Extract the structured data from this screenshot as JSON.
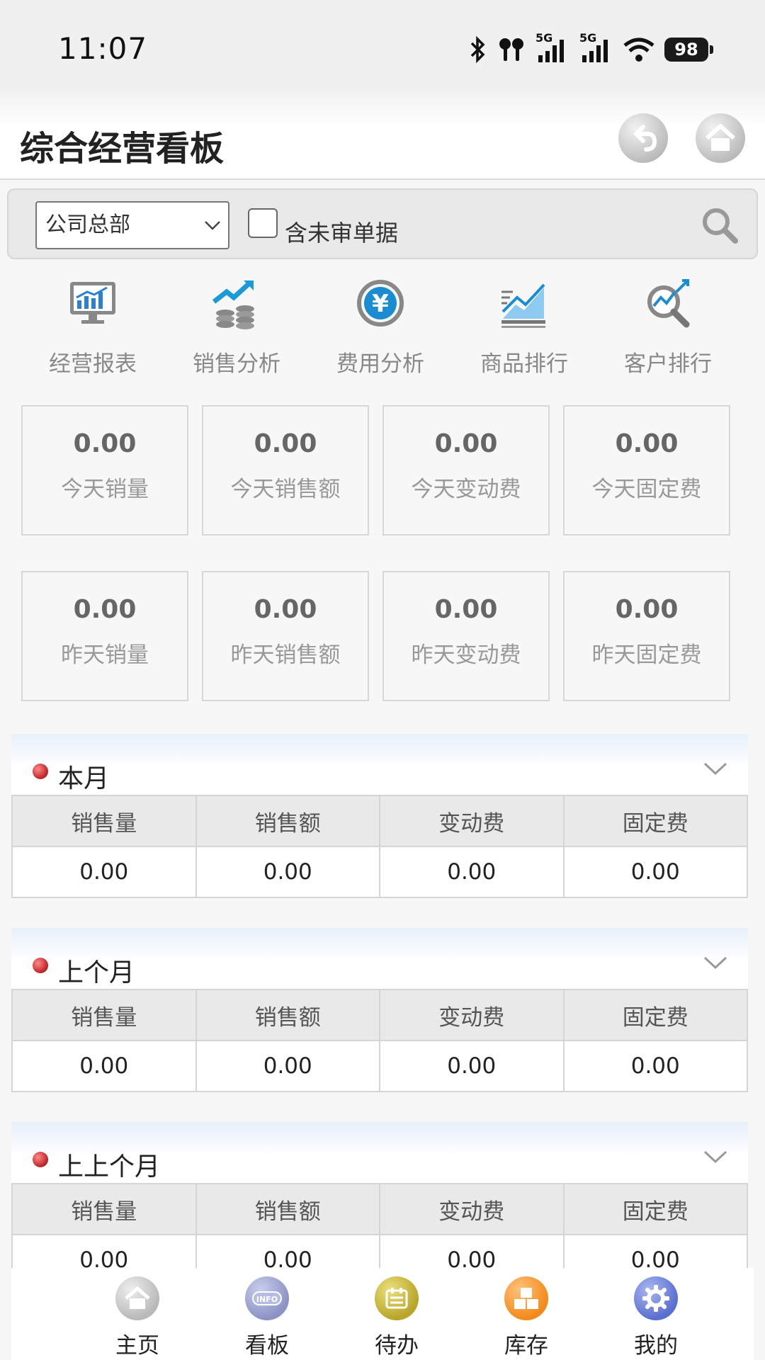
{
  "status": {
    "time": "11:07",
    "net1": "5G",
    "net2": "5G",
    "battery": "98"
  },
  "header": {
    "title": "综合经营看板",
    "back_icon": "back-arrow-icon",
    "home_icon": "home-icon"
  },
  "filter": {
    "org_selected": "公司总部",
    "include_unapproved_label": "含未审单据",
    "include_unapproved_checked": false
  },
  "quicknav": [
    {
      "label": "经营报表",
      "icon": "monitor-chart-icon"
    },
    {
      "label": "销售分析",
      "icon": "sales-growth-icon"
    },
    {
      "label": "费用分析",
      "icon": "yen-coin-icon"
    },
    {
      "label": "商品排行",
      "icon": "ranking-chart-icon"
    },
    {
      "label": "客户排行",
      "icon": "customer-search-icon"
    }
  ],
  "today": [
    {
      "value": "0.00",
      "label": "今天销量"
    },
    {
      "value": "0.00",
      "label": "今天销售额"
    },
    {
      "value": "0.00",
      "label": "今天变动费"
    },
    {
      "value": "0.00",
      "label": "今天固定费"
    }
  ],
  "yesterday": [
    {
      "value": "0.00",
      "label": "昨天销量"
    },
    {
      "value": "0.00",
      "label": "昨天销售额"
    },
    {
      "value": "0.00",
      "label": "昨天变动费"
    },
    {
      "value": "0.00",
      "label": "昨天固定费"
    }
  ],
  "sections": [
    {
      "title": "本月",
      "headers": [
        "销售量",
        "销售额",
        "变动费",
        "固定费"
      ],
      "values": [
        "0.00",
        "0.00",
        "0.00",
        "0.00"
      ]
    },
    {
      "title": "上个月",
      "headers": [
        "销售量",
        "销售额",
        "变动费",
        "固定费"
      ],
      "values": [
        "0.00",
        "0.00",
        "0.00",
        "0.00"
      ]
    },
    {
      "title": "上上个月",
      "headers": [
        "销售量",
        "销售额",
        "变动费",
        "固定费"
      ],
      "values": [
        "0.00",
        "0.00",
        "0.00",
        "0.00"
      ]
    }
  ],
  "bottomnav": [
    {
      "label": "主页",
      "icon": "home-icon",
      "color": "#b9b9b9"
    },
    {
      "label": "看板",
      "icon": "info-icon",
      "color": "#8c93c4"
    },
    {
      "label": "待办",
      "icon": "todo-icon",
      "color": "#b8a52a"
    },
    {
      "label": "库存",
      "icon": "boxes-icon",
      "color": "#f28a1c"
    },
    {
      "label": "我的",
      "icon": "gear-icon",
      "color": "#5a6fd0"
    }
  ]
}
